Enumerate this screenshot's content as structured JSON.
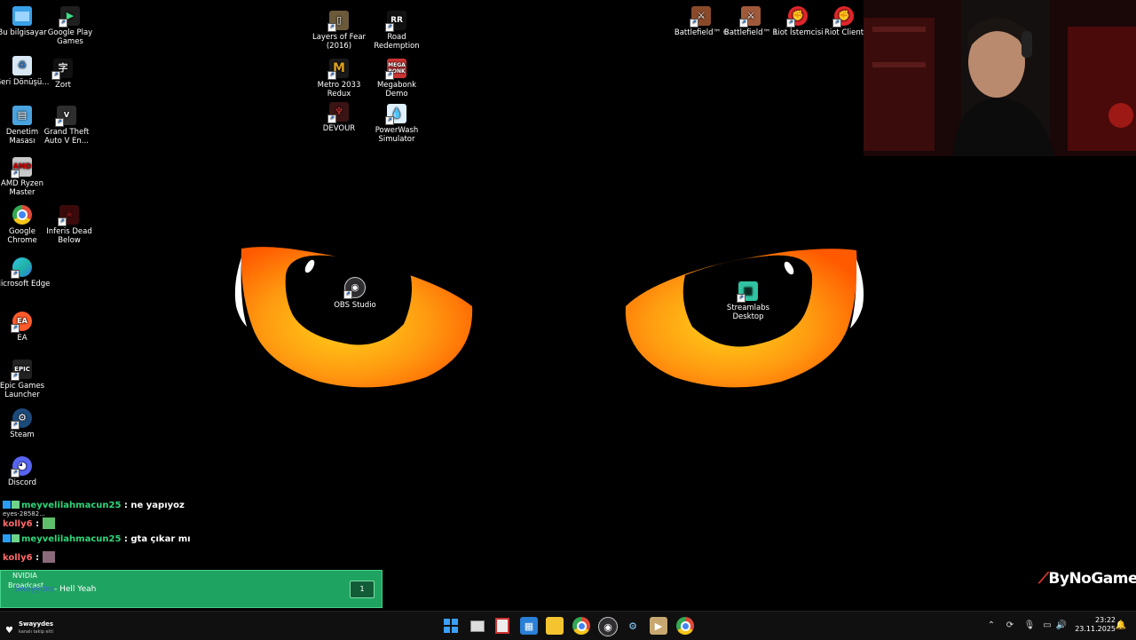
{
  "desktop": {
    "icons_left": [
      {
        "label": "Bu bilgisayar",
        "icon": "monitor-icon",
        "color": "#3aa0e8"
      },
      {
        "label": "Google Play Games",
        "icon": "play-games-icon",
        "color": "#3ddc84"
      },
      {
        "label": "Geri Dönüşü...",
        "icon": "recycle-bin-icon",
        "color": "#bcd9f0"
      },
      {
        "label": "Zort",
        "icon": "zort-icon",
        "color": "#ddd"
      },
      {
        "label": "Denetim Masası",
        "icon": "control-panel-icon",
        "color": "#4aa3df"
      },
      {
        "label": "Grand Theft Auto V En...",
        "icon": "gta-icon",
        "color": "#2e2e2e"
      },
      {
        "label": "AMD Ryzen Master",
        "icon": "amd-icon",
        "color": "#d3d3d3"
      },
      {
        "label": "Google Chrome",
        "icon": "chrome-icon",
        "color": "#e04a3a"
      },
      {
        "label": "Inferis Dead Below",
        "icon": "inferis-icon",
        "color": "#6a1010"
      },
      {
        "label": "Microsoft Edge",
        "icon": "edge-icon",
        "color": "#1fb5a5"
      },
      {
        "label": "EA",
        "icon": "ea-icon",
        "color": "#ff5a2a"
      },
      {
        "label": "Epic Games Launcher",
        "icon": "epic-icon",
        "color": "#222"
      },
      {
        "label": "Steam",
        "icon": "steam-icon",
        "color": "#1b2838"
      },
      {
        "label": "Discord",
        "icon": "discord-icon",
        "color": "#5865f2"
      }
    ],
    "icons_top": [
      {
        "label": "Layers of Fear (2016)",
        "icon": "layers-of-fear-icon",
        "color": "#6b5a3a"
      },
      {
        "label": "Road Redemption",
        "icon": "road-redemption-icon",
        "color": "#111"
      },
      {
        "label": "Metro 2033 Redux",
        "icon": "metro-icon",
        "color": "#d9a020"
      },
      {
        "label": "Megabonk Demo",
        "icon": "megabonk-icon",
        "color": "#c33"
      },
      {
        "label": "DEVOUR",
        "icon": "devour-icon",
        "color": "#3a1414"
      },
      {
        "label": "PowerWash Simulator",
        "icon": "powerwash-icon",
        "color": "#2a7fd6"
      }
    ],
    "icons_right": [
      {
        "label": "Battlefield™ 6",
        "icon": "battlefield6-icon",
        "color": "#8a4a2a"
      },
      {
        "label": "Battlefield™ 1",
        "icon": "battlefield1-icon",
        "color": "#a05a3a"
      },
      {
        "label": "Riot İstemcisi",
        "icon": "riot-icon",
        "color": "#e0262b"
      },
      {
        "label": "Riot Client",
        "icon": "riot-icon",
        "color": "#e0262b"
      }
    ],
    "icons_center": [
      {
        "label": "OBS Studio",
        "icon": "obs-icon",
        "color": "#302e31"
      },
      {
        "label": "Streamlabs Desktop",
        "icon": "streamlabs-icon",
        "color": "#31c3a2"
      }
    ]
  },
  "chat": [
    {
      "user": "meyvelilahmacun25",
      "sep": " : ",
      "text": "ne yapıyoz",
      "sub": "eyes-28582..."
    },
    {
      "user": "kolly6",
      "sep": " : ",
      "text": ""
    },
    {
      "user": "meyvelilahmacun25",
      "sep": " : ",
      "text": "gta çıkar mı"
    },
    {
      "user": "kolly6",
      "sep": " : ",
      "text": ""
    }
  ],
  "notification": {
    "app": "NVIDIA",
    "sub": "Broadcast",
    "user": "Swayydes",
    "text": "- Hell Yeah",
    "count": "1",
    "bg": "#1fa360"
  },
  "follow": {
    "name": "Swayydes",
    "text": "kanalı takip etti"
  },
  "watermark": "ByNoGame",
  "taskbar": {
    "apps": [
      "windows-start-icon",
      "task-view-icon",
      "snipping-icon",
      "photos-icon",
      "file-explorer-icon",
      "chrome-icon",
      "obs-icon",
      "steam-icon",
      "media-icon",
      "chrome-alt-icon"
    ],
    "time": "23:22",
    "date": "23.11.2025"
  }
}
